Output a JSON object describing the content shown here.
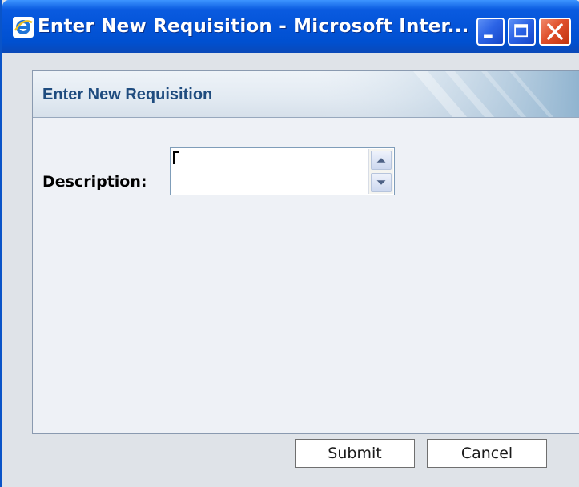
{
  "window": {
    "title": "Enter New Requisition - Microsoft Inter...",
    "controls": {
      "minimize_icon": "minimize-icon",
      "maximize_icon": "maximize-icon",
      "close_icon": "close-icon"
    }
  },
  "dialog": {
    "heading": "Enter New Requisition",
    "description_label": "Description:",
    "description_value": "",
    "buttons": {
      "submit": "Submit",
      "cancel": "Cancel"
    }
  },
  "colors": {
    "titlebar": "#0454d8",
    "heading_text": "#1f4c7f",
    "close_button": "#e0502c"
  }
}
